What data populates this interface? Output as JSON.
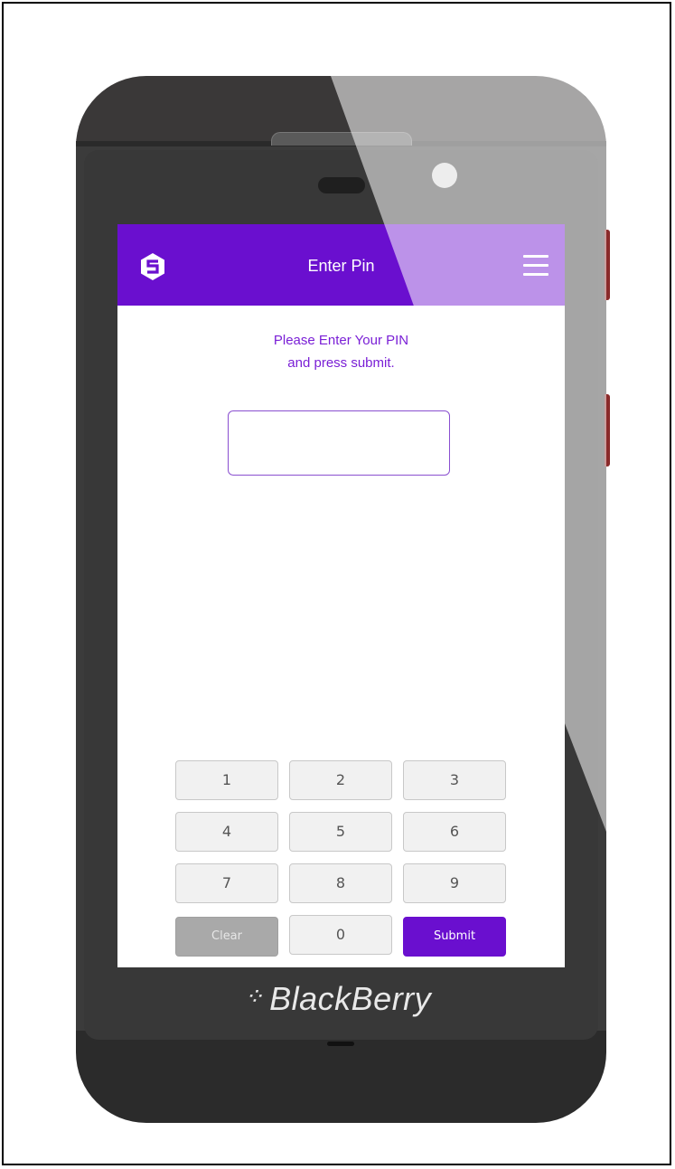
{
  "device": {
    "brand_name": "BlackBerry",
    "brand_logo": "⁘"
  },
  "header": {
    "title": "Enter Pin",
    "logo_icon": "hexagon-s-logo-icon",
    "menu_icon": "hamburger-menu-icon"
  },
  "instruction": {
    "line1": "Please Enter Your PIN",
    "line2": "and press submit."
  },
  "pin_field": {
    "value": "",
    "placeholder": ""
  },
  "keypad": {
    "keys": [
      "1",
      "2",
      "3",
      "4",
      "5",
      "6",
      "7",
      "8",
      "9"
    ],
    "clear_label": "Clear",
    "zero_label": "0",
    "submit_label": "Submit"
  },
  "colors": {
    "brand_purple": "#6a0fcf",
    "instruction_purple": "#7a1fd6",
    "clear_gray": "#a9a9a9"
  }
}
